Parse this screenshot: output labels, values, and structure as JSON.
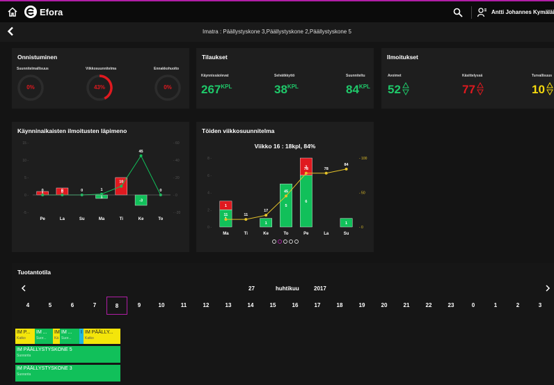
{
  "app": {
    "brand": "Efora",
    "user": "Antti Johannes Kymäläinen"
  },
  "subheader": {
    "title": "Imatra : Päällystyskone 3,Päällystyskone 2,Päällystyskone 5"
  },
  "onnistuminen": {
    "title": "Onnistuminen",
    "gauges": [
      {
        "label": "Suunnitelmallisuus",
        "value": "0%",
        "percent": 0
      },
      {
        "label": "Viikkosuunnitelma",
        "value": "43%",
        "percent": 43
      },
      {
        "label": "Ennakkohuolto",
        "value": "0%",
        "percent": 0
      }
    ]
  },
  "tilaukset": {
    "title": "Tilaukset",
    "items": [
      {
        "label": "Käynnissäolevat",
        "value": "267",
        "unit": "KPL"
      },
      {
        "label": "Selvätkkyttö",
        "value": "38",
        "unit": "KPL"
      },
      {
        "label": "Suunniteltu",
        "value": "84",
        "unit": "KPL"
      }
    ]
  },
  "ilmoitukset": {
    "title": "Ilmoitukset",
    "items": [
      {
        "label": "Avoimet",
        "value": "52",
        "color": "#1fc96a"
      },
      {
        "label": "Käsittelyssä",
        "value": "77",
        "color": "#e0191f"
      },
      {
        "label": "Turvallisuus",
        "value": "10",
        "color": "#f5d90e"
      }
    ]
  },
  "chart_left_title": "Käynninaikaisten ilmoitusten läpimeno",
  "chart_right_title": "Töiden viikkosuunnitelma",
  "chart_right_subtitle": "Viikko 16 : 18kpl, 84%",
  "chart_data": [
    {
      "type": "bar",
      "categories": [
        "Pe",
        "La",
        "Su",
        "Ma",
        "Ti",
        "Ke",
        "To"
      ],
      "ylim": [
        -5,
        15
      ],
      "y2lim": [
        -20,
        60
      ],
      "yticks": [
        -5,
        0,
        5,
        10,
        15
      ],
      "y2ticks": [
        -20,
        0,
        20,
        40,
        60
      ],
      "series": [
        {
          "color": "#e0191f",
          "values": [
            1,
            2,
            0,
            0,
            5,
            0,
            0
          ],
          "labels": [
            "1",
            "0",
            "",
            "",
            "5",
            "",
            ""
          ]
        },
        {
          "color": "#11c05a",
          "values": [
            0,
            0,
            0,
            -1,
            0,
            -3,
            0
          ],
          "labels": [
            "",
            "",
            "",
            "1",
            "",
            "-3",
            ""
          ]
        },
        {
          "color": "#11c05a",
          "kind": "line",
          "values": [
            0,
            0,
            0,
            1,
            10,
            45,
            0
          ],
          "labels": [
            "0",
            "0",
            "0",
            "1",
            "10",
            "45",
            "0"
          ]
        }
      ]
    },
    {
      "type": "bar",
      "title": "Viikko 16 : 18kpl, 84%",
      "categories": [
        "Ma",
        "Ti",
        "Ke",
        "To",
        "Pe",
        "La",
        "Su"
      ],
      "ylim": [
        0,
        8
      ],
      "y2lim": [
        0,
        100
      ],
      "yticks": [
        0,
        2,
        4,
        6,
        8
      ],
      "y2ticks": [
        0,
        50,
        100
      ],
      "series": [
        {
          "name": "green",
          "color": "#11c05a",
          "values": [
            2,
            0,
            1,
            5,
            6,
            0,
            1
          ],
          "labels": [
            "1",
            "",
            "1",
            "5",
            "6",
            "",
            "1"
          ]
        },
        {
          "name": "red",
          "color": "#e0191f",
          "values": [
            1,
            0,
            0,
            0,
            2,
            0,
            0
          ],
          "labels": [
            "1",
            "",
            "",
            "",
            "2",
            "",
            ""
          ]
        },
        {
          "color": "#e6c32a",
          "kind": "line",
          "values": [
            11,
            11,
            17,
            45,
            78,
            78,
            84
          ],
          "labels": [
            "11",
            "11",
            "17",
            "45",
            "78",
            "78",
            "84"
          ]
        }
      ]
    }
  ],
  "tuotantotila": {
    "title": "Tuotantotila",
    "day": "27",
    "month": "huhtikuu",
    "year": "2017",
    "days": [
      "4",
      "5",
      "6",
      "7",
      "8",
      "9",
      "10",
      "11",
      "12",
      "13",
      "14",
      "15",
      "16",
      "17",
      "18",
      "19",
      "20",
      "21",
      "22",
      "23",
      "0",
      "1",
      "2",
      "3"
    ],
    "selected_index": 4,
    "items": [
      {
        "title": "IM P...",
        "sub": "Katko",
        "style": "y"
      },
      {
        "title": "IM ...",
        "sub": "Suor...",
        "style": "g"
      },
      {
        "title": "IM",
        "sub": "Kä",
        "style": "y"
      },
      {
        "title": "IM ...",
        "sub": "Suor...",
        "style": "g"
      },
      {
        "title": "I",
        "sub": "",
        "style": "c"
      },
      {
        "title": "IM PÄÄLLY...",
        "sub": "Katko",
        "style": "y"
      },
      {
        "title": "IM PÄÄLLYSTYSKONE 5",
        "sub": "Suoranta",
        "style": "g"
      },
      {
        "title": "IM PÄÄLLYSTYSKONE 3",
        "sub": "Suoranta",
        "style": "g"
      }
    ]
  }
}
